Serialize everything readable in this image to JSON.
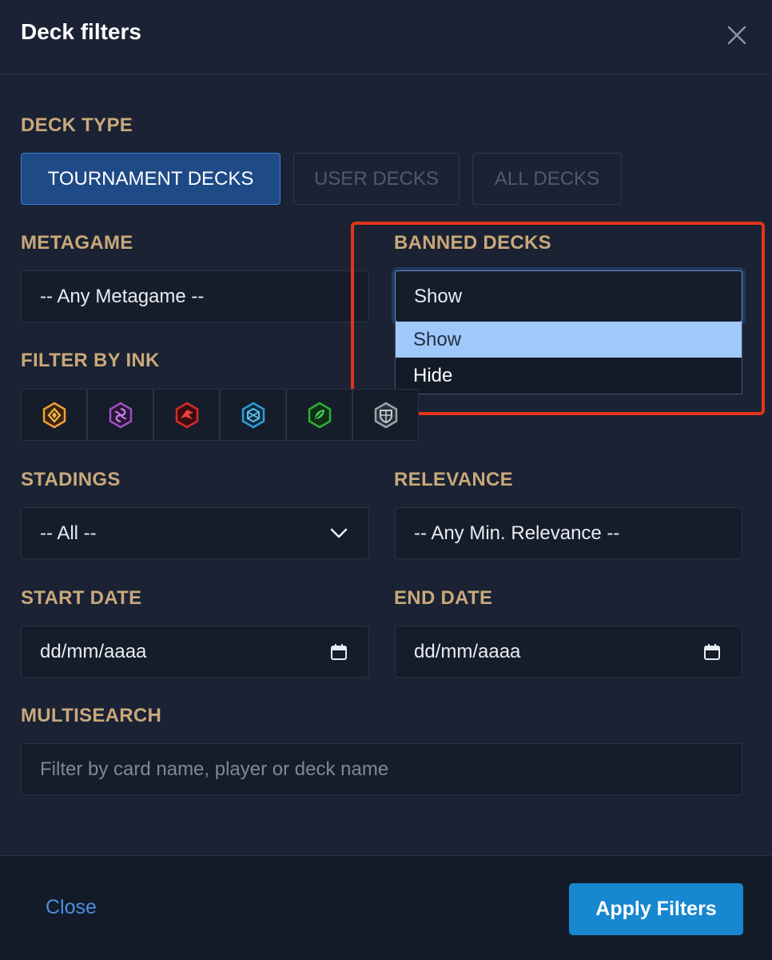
{
  "modal": {
    "title": "Deck filters"
  },
  "deck_type": {
    "label": "DECK TYPE",
    "options": [
      "TOURNAMENT DECKS",
      "USER DECKS",
      "ALL DECKS"
    ],
    "selected": "TOURNAMENT DECKS"
  },
  "metagame": {
    "label": "METAGAME",
    "value": "-- Any Metagame --"
  },
  "banned_decks": {
    "label": "BANNED DECKS",
    "value": "Show",
    "options": [
      "Show",
      "Hide"
    ],
    "highlighted_option": "Show"
  },
  "ink": {
    "label": "FILTER BY INK",
    "icons": [
      "amber-ink-icon",
      "amethyst-ink-icon",
      "ruby-ink-icon",
      "sapphire-ink-icon",
      "emerald-ink-icon",
      "steel-ink-icon"
    ],
    "colors": [
      "#f0a030",
      "#9b4fc0",
      "#d62b2b",
      "#2a9fd8",
      "#2fae3c",
      "#9aa3ad"
    ]
  },
  "standings": {
    "label": "STADINGS",
    "value": "-- All --"
  },
  "relevance": {
    "label": "RELEVANCE",
    "value": "-- Any Min. Relevance --"
  },
  "start_date": {
    "label": "START DATE",
    "value": "dd/mm/aaaa"
  },
  "end_date": {
    "label": "END DATE",
    "value": "dd/mm/aaaa"
  },
  "multisearch": {
    "label": "MULTISEARCH",
    "placeholder": "Filter by card name, player or deck name"
  },
  "footer": {
    "close_label": "Close",
    "apply_label": "Apply Filters"
  },
  "colors": {
    "accent": "#1787d0",
    "label": "#c9a87a",
    "highlight_outline": "#e0361a",
    "selected_option": "#a0c8fa"
  }
}
